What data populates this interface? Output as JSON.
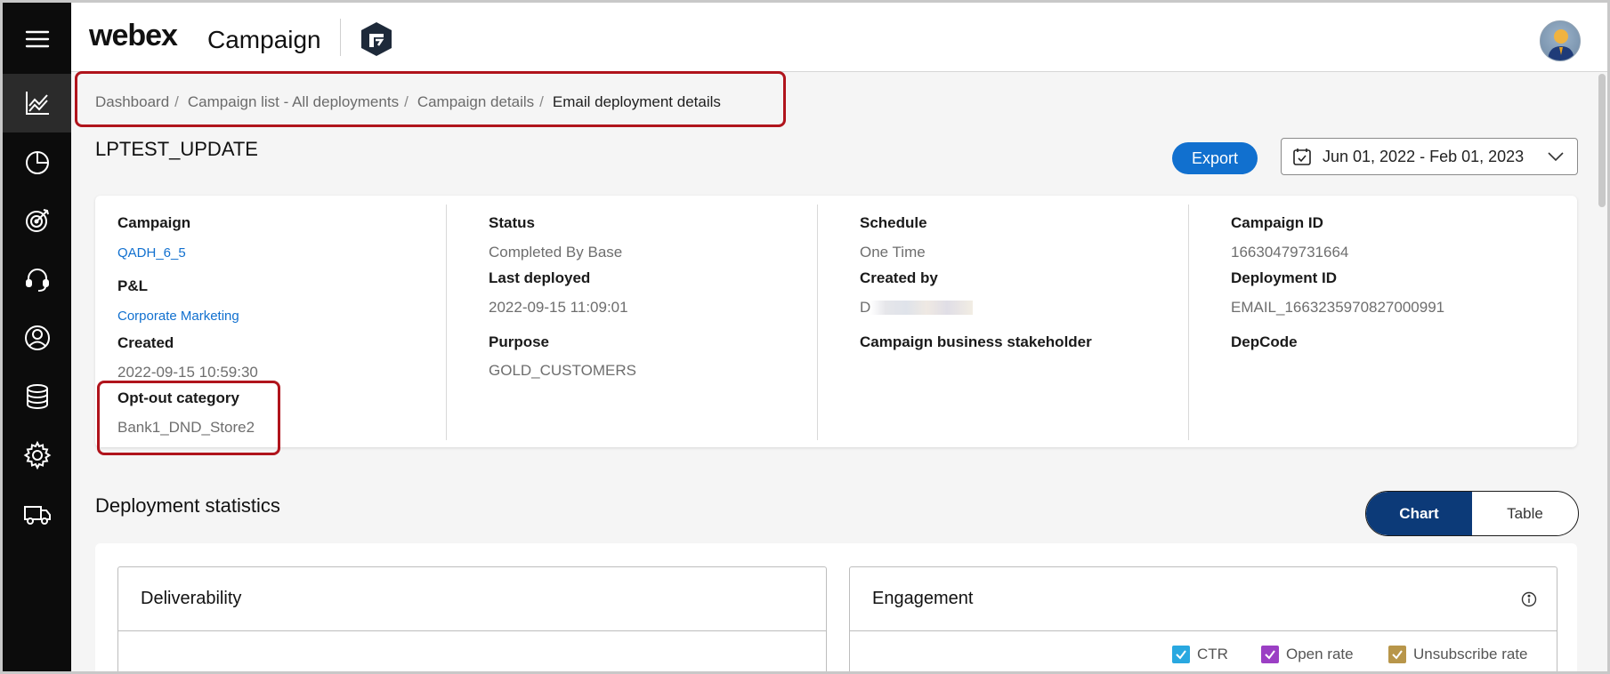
{
  "header": {
    "brand_name": "webex",
    "product_name": "Campaign"
  },
  "sidebar": {
    "items": [
      {
        "name": "menu-icon"
      },
      {
        "name": "analytics-icon",
        "active": true
      },
      {
        "name": "pie-chart-icon"
      },
      {
        "name": "target-icon"
      },
      {
        "name": "headset-icon"
      },
      {
        "name": "user-circle-icon"
      },
      {
        "name": "database-icon"
      },
      {
        "name": "gear-icon"
      },
      {
        "name": "truck-icon"
      }
    ]
  },
  "breadcrumb": {
    "items": [
      "Dashboard",
      "Campaign list - All deployments",
      "Campaign details"
    ],
    "separator": "/",
    "current": "Email deployment details"
  },
  "page": {
    "title": "LPTEST_UPDATE",
    "export_label": "Export",
    "date_range": "Jun 01, 2022 - Feb 01, 2023"
  },
  "details": {
    "campaign_label": "Campaign",
    "campaign_value": "QADH_6_5",
    "pl_label": "P&L",
    "pl_value": "Corporate Marketing",
    "created_label": "Created",
    "created_value": "2022-09-15 10:59:30",
    "optout_label": "Opt-out category",
    "optout_value": "Bank1_DND_Store2",
    "status_label": "Status",
    "status_value": "Completed By Base",
    "last_deployed_label": "Last deployed",
    "last_deployed_value": "2022-09-15 11:09:01",
    "purpose_label": "Purpose",
    "purpose_value": "GOLD_CUSTOMERS",
    "schedule_label": "Schedule",
    "schedule_value": "One Time",
    "created_by_label": "Created by",
    "created_by_value": "D",
    "stakeholder_label": "Campaign business stakeholder",
    "campaign_id_label": "Campaign ID",
    "campaign_id_value": "16630479731664",
    "deployment_id_label": "Deployment ID",
    "deployment_id_value": "EMAIL_1663235970827000991",
    "depcode_label": "DepCode"
  },
  "stats": {
    "title": "Deployment statistics",
    "view_options": [
      "Chart",
      "Table"
    ],
    "selected_view": "Chart",
    "deliverability_title": "Deliverability",
    "engagement_title": "Engagement",
    "legend": [
      {
        "label": "CTR",
        "color": "#29a8e0",
        "checked": true
      },
      {
        "label": "Open rate",
        "color": "#9b3fc4",
        "checked": true
      },
      {
        "label": "Unsubscribe rate",
        "color": "#b8964a",
        "checked": true
      }
    ]
  },
  "colors": {
    "accent_blue": "#1170cf",
    "toggle_active": "#0c3a78",
    "highlight_red": "#b0141c",
    "sidebar_bg": "#0c0c0c"
  }
}
